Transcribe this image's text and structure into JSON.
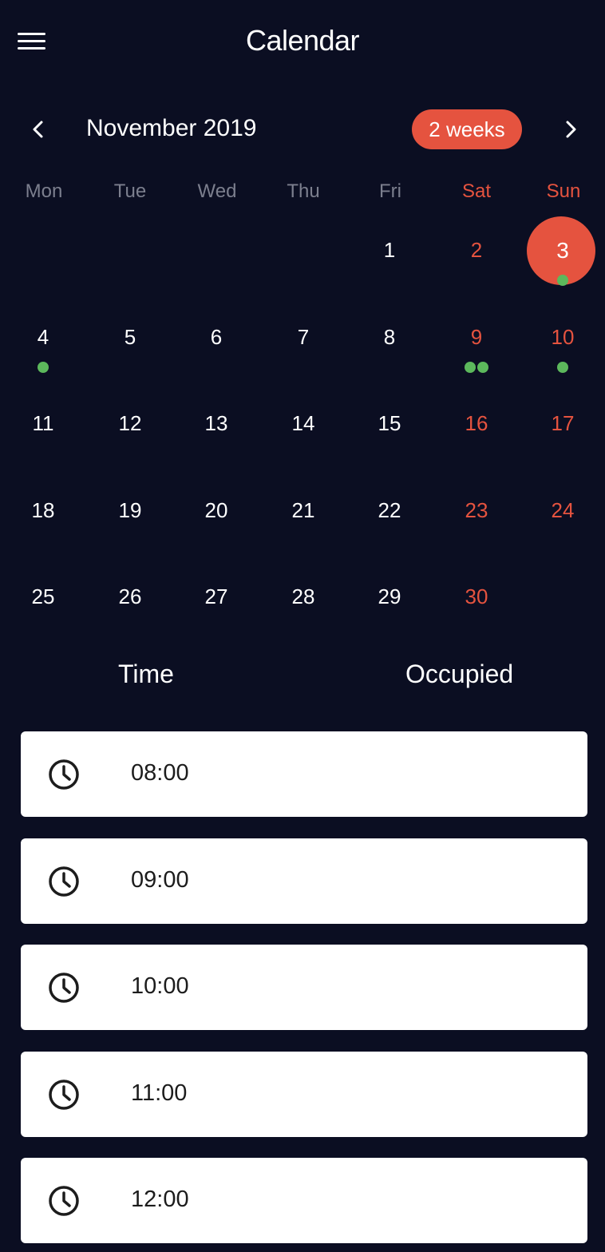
{
  "header": {
    "title": "Calendar",
    "menu_icon": "hamburger-menu-icon"
  },
  "month_nav": {
    "month_label": "November 2019",
    "range_label": "2 weeks",
    "prev_icon": "chevron-left-icon",
    "next_icon": "chevron-right-icon"
  },
  "colors": {
    "background": "#0b0e22",
    "accent": "#e5533f",
    "event_dot": "#5cb85c",
    "weekday_muted": "#7c7f8e"
  },
  "weekdays": [
    "Mon",
    "Tue",
    "Wed",
    "Thu",
    "Fri",
    "Sat",
    "Sun"
  ],
  "days": [
    {
      "label": "1",
      "weekday": 4,
      "week": 0,
      "dots": 0
    },
    {
      "label": "2",
      "weekday": 5,
      "week": 0,
      "dots": 0
    },
    {
      "label": "3",
      "weekday": 6,
      "week": 0,
      "dots": 1,
      "selected": true
    },
    {
      "label": "4",
      "weekday": 0,
      "week": 1,
      "dots": 1
    },
    {
      "label": "5",
      "weekday": 1,
      "week": 1,
      "dots": 0
    },
    {
      "label": "6",
      "weekday": 2,
      "week": 1,
      "dots": 0
    },
    {
      "label": "7",
      "weekday": 3,
      "week": 1,
      "dots": 0
    },
    {
      "label": "8",
      "weekday": 4,
      "week": 1,
      "dots": 0
    },
    {
      "label": "9",
      "weekday": 5,
      "week": 1,
      "dots": 2
    },
    {
      "label": "10",
      "weekday": 6,
      "week": 1,
      "dots": 1
    },
    {
      "label": "11",
      "weekday": 0,
      "week": 2,
      "dots": 0
    },
    {
      "label": "12",
      "weekday": 1,
      "week": 2,
      "dots": 0
    },
    {
      "label": "13",
      "weekday": 2,
      "week": 2,
      "dots": 0
    },
    {
      "label": "14",
      "weekday": 3,
      "week": 2,
      "dots": 0
    },
    {
      "label": "15",
      "weekday": 4,
      "week": 2,
      "dots": 0
    },
    {
      "label": "16",
      "weekday": 5,
      "week": 2,
      "dots": 0
    },
    {
      "label": "17",
      "weekday": 6,
      "week": 2,
      "dots": 0
    },
    {
      "label": "18",
      "weekday": 0,
      "week": 3,
      "dots": 0
    },
    {
      "label": "19",
      "weekday": 1,
      "week": 3,
      "dots": 0
    },
    {
      "label": "20",
      "weekday": 2,
      "week": 3,
      "dots": 0
    },
    {
      "label": "21",
      "weekday": 3,
      "week": 3,
      "dots": 0
    },
    {
      "label": "22",
      "weekday": 4,
      "week": 3,
      "dots": 0
    },
    {
      "label": "23",
      "weekday": 5,
      "week": 3,
      "dots": 0
    },
    {
      "label": "24",
      "weekday": 6,
      "week": 3,
      "dots": 0
    },
    {
      "label": "25",
      "weekday": 0,
      "week": 4,
      "dots": 0
    },
    {
      "label": "26",
      "weekday": 1,
      "week": 4,
      "dots": 0
    },
    {
      "label": "27",
      "weekday": 2,
      "week": 4,
      "dots": 0
    },
    {
      "label": "28",
      "weekday": 3,
      "week": 4,
      "dots": 0
    },
    {
      "label": "29",
      "weekday": 4,
      "week": 4,
      "dots": 0
    },
    {
      "label": "30",
      "weekday": 5,
      "week": 4,
      "dots": 0
    }
  ],
  "table": {
    "time_header": "Time",
    "occupied_header": "Occupied"
  },
  "slots": [
    {
      "time": "08:00",
      "icon": "clock-icon"
    },
    {
      "time": "09:00",
      "icon": "clock-icon"
    },
    {
      "time": "10:00",
      "icon": "clock-icon"
    },
    {
      "time": "11:00",
      "icon": "clock-icon"
    },
    {
      "time": "12:00",
      "icon": "clock-icon"
    }
  ]
}
